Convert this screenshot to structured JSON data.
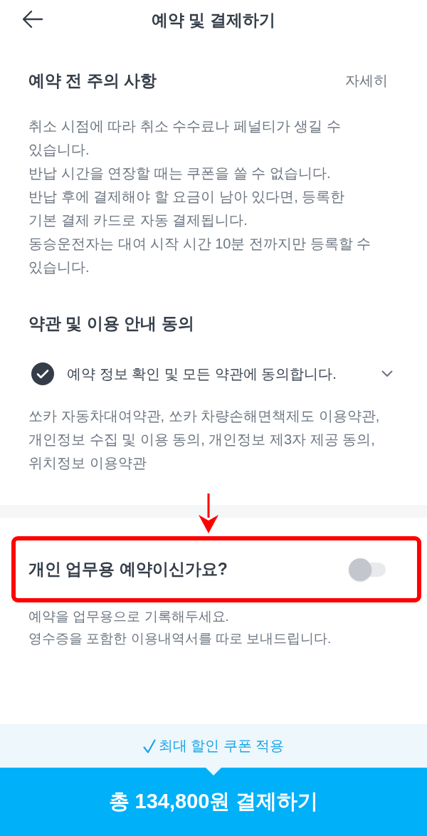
{
  "header": {
    "title": "예약 및 결제하기"
  },
  "notice": {
    "title": "예약 전 주의 사항",
    "link": "자세히",
    "paragraphs": [
      "취소 시점에 따라 취소 수수료나 페널티가 생길 수\n있습니다.",
      "반납 시간을 연장할 때는 쿠폰을 쓸 수 없습니다.",
      "반납 후에 결제해야 할 요금이 남아 있다면, 등록한\n기본 결제 카드로 자동 결제됩니다.",
      "동승운전자는 대여 시작 시간 10분 전까지만 등록할 수\n있습니다."
    ]
  },
  "terms": {
    "title": "약관 및 이용 안내 동의",
    "agree_all": {
      "label": "예약 정보 확인 및 모든 약관에 동의합니다.",
      "checked": true
    },
    "summary": "쏘카 자동차대여약관, 쏘카 차량손해면책제도 이용약관,\n개인정보 수집 및 이용 동의, 개인정보 제3자 제공 동의,\n위치정보 이용약관"
  },
  "business_use": {
    "label": "개인 업무용 예약이신가요?",
    "on": false,
    "description": [
      "예약을 업무용으로 기록해두세요.",
      "영수증을 포함한 이용내역서를 따로 보내드립니다."
    ]
  },
  "coupon": {
    "label": "최대 할인 쿠폰 적용"
  },
  "pay_button": {
    "label": "총 134,800원 결제하기"
  }
}
